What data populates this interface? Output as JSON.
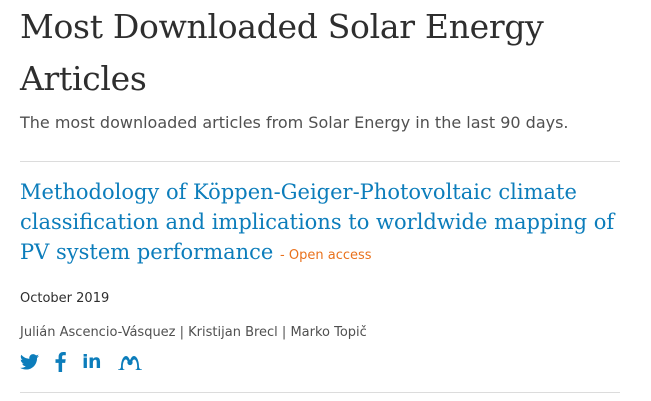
{
  "header": {
    "title_line1": "Most Downloaded Solar Energy",
    "title_line2": "Articles",
    "subtitle": "The most downloaded articles from Solar Energy in the last 90 days."
  },
  "article": {
    "title": "Methodology of Köppen-Geiger-Photovoltaic climate classification and implications to worldwide mapping of PV system performance",
    "access_label": "- Open access",
    "date": "October 2019",
    "authors": "Julián Ascencio-Vásquez | Kristijan Brecl | Marko Topič"
  },
  "share": {
    "icons": [
      "twitter-icon",
      "facebook-icon",
      "linkedin-icon",
      "mendeley-icon"
    ],
    "linkedin_text": "in"
  },
  "colors": {
    "link": "#0c7dbb",
    "open_access": "#e9711c",
    "text": "#2e2e2e",
    "divider": "#dcdcdc"
  }
}
